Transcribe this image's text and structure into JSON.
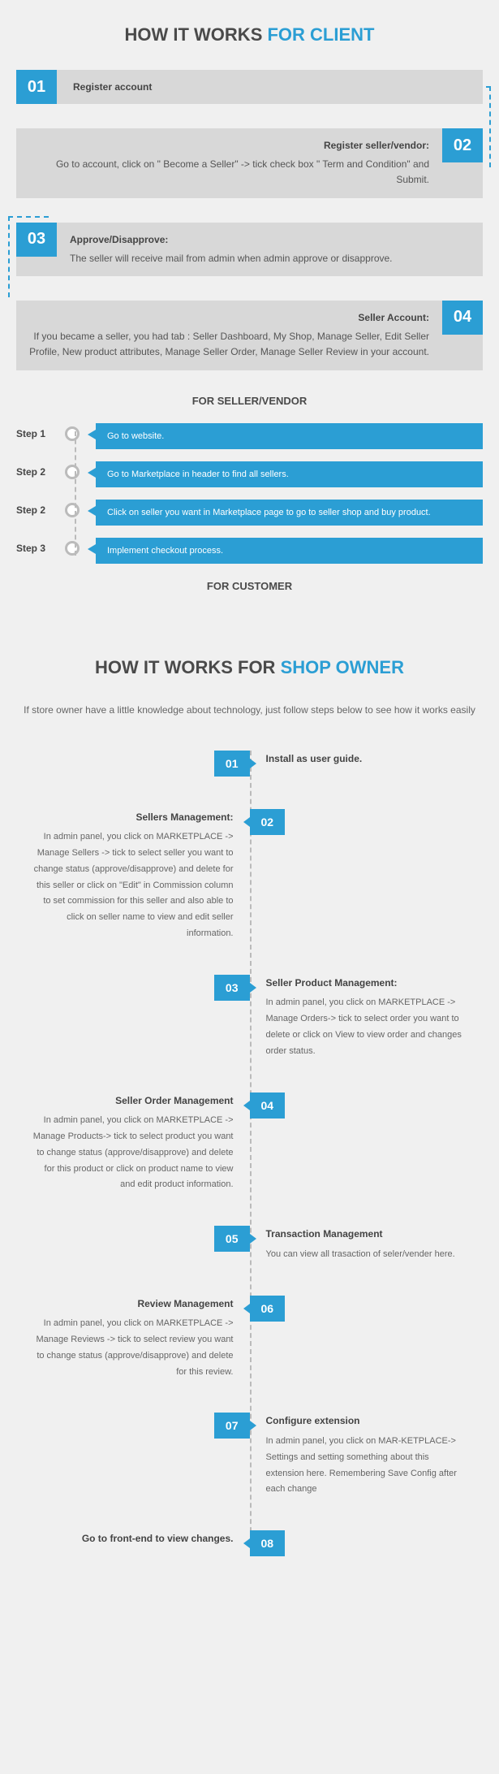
{
  "client": {
    "title_prefix": "HOW IT WORKS ",
    "title_suffix": "FOR CLIENT",
    "steps": [
      {
        "num": "01",
        "label": "Register account"
      },
      {
        "num": "02",
        "title": "Register seller/vendor:",
        "body": "Go to account, click on \" Become a Seller\" -> tick check box \" Term and Condition\" and Submit."
      },
      {
        "num": "03",
        "title": "Approve/Disapprove:",
        "body": "The seller will receive mail from admin when admin approve or disapprove."
      },
      {
        "num": "04",
        "title": "Seller Account:",
        "body": "If you became a seller, you had tab : Seller Dashboard, My Shop, Manage Seller, Edit Seller Profile, New product attributes, Manage Seller Order, Manage Seller Review in your account."
      }
    ]
  },
  "seller_vendor": {
    "heading": "FOR SELLER/VENDOR",
    "steps": [
      {
        "label": "Step 1",
        "body": "Go to website."
      },
      {
        "label": "Step 2",
        "body": "Go to Marketplace in header to find all sellers."
      },
      {
        "label": "Step 2",
        "body": "Click on seller you want in Marketplace page to go to seller shop and buy product."
      },
      {
        "label": "Step 3",
        "body": "Implement checkout process."
      }
    ]
  },
  "customer_heading": "FOR CUSTOMER",
  "shop_owner": {
    "title_prefix": "HOW IT WORKS FOR ",
    "title_suffix": "SHOP OWNER",
    "subtitle": "If store owner have a little knowledge about technology, just follow steps below to see how it works easily",
    "steps": [
      {
        "num": "01",
        "title": "",
        "body": "Install as user guide."
      },
      {
        "num": "02",
        "title": "Sellers Management:",
        "body": "In admin panel, you click on MARKETPLACE -> Manage Sellers -> tick to select seller you want to change status (approve/disapprove) and delete for this seller or click on \"Edit\" in Commission column to set commission for this seller and also able to click on seller name to view and edit seller information."
      },
      {
        "num": "03",
        "title": "Seller Product Management:",
        "body": "In admin panel, you click on MARKETPLACE -> Manage Orders-> tick to select order you want to delete or  click on View to view order and changes order status."
      },
      {
        "num": "04",
        "title": "Seller Order Management",
        "body": "In admin panel, you click on MARKETPLACE -> Manage Products-> tick to select product you want to change status (approve/disapprove) and delete for this product or  click on product name to view and edit product information."
      },
      {
        "num": "05",
        "title": "Transaction Management",
        "body": "You can view all trasaction of seler/vender here."
      },
      {
        "num": "06",
        "title": "Review Management",
        "body": "In admin panel, you click on MARKETPLACE -> Manage Reviews -> tick to select review you want to change status (approve/disapprove) and delete for this review."
      },
      {
        "num": "07",
        "title": "Configure extension",
        "body": "In admin panel, you click on MAR-KETPLACE-> Settings and setting something about this extension here. Remembering Save Config after each change"
      },
      {
        "num": "08",
        "title": "",
        "body": "Go to front-end to view changes."
      }
    ]
  }
}
